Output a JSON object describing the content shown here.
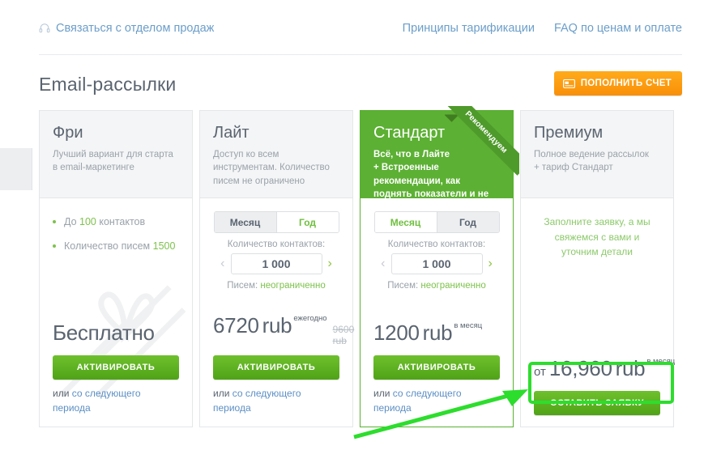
{
  "topbar": {
    "sales_link": "Связаться с отделом продаж",
    "sales_icon": "headset-icon",
    "links": [
      {
        "label": "Принципы тарификации"
      },
      {
        "label": "FAQ по ценам и оплате"
      }
    ]
  },
  "header": {
    "title": "Email-рассылки",
    "topup_button": "ПОПОЛНИТЬ СЧЕТ",
    "topup_icon": "credit-card-icon"
  },
  "colors": {
    "brand_green": "#5cb033",
    "cta_green": "#5faf1e",
    "accent_orange": "#f99a0d",
    "link_blue": "#6b9ec9",
    "text_gray": "#5a6470",
    "muted_gray": "#9aa2aa",
    "annotation_green": "#2ddd2d"
  },
  "plans": [
    {
      "id": "free",
      "name": "Фри",
      "description": "Лучший вариант для старта в email-маркетинге",
      "featured": false,
      "features": [
        {
          "prefix": "До ",
          "value": "100",
          "suffix": " контактов"
        },
        {
          "prefix": "Количество писем ",
          "value": "1500",
          "suffix": ""
        }
      ],
      "price": {
        "prefix": "",
        "amount": "Бесплатно",
        "currency": "",
        "period": "",
        "old": ""
      },
      "cta": "АКТИВИРОВАТЬ",
      "or_prefix": "или ",
      "or_link": "со следующего периода"
    },
    {
      "id": "light",
      "name": "Лайт",
      "description": "Доступ ко всем инструментам. Количество писем не ограничено",
      "featured": false,
      "toggle": {
        "options": [
          "Месяц",
          "Год"
        ],
        "selected": "Год"
      },
      "contacts_label": "Количество контактов:",
      "contacts_value": "1 000",
      "limit_prefix": "Писем: ",
      "limit_value": "неограниченно",
      "price": {
        "prefix": "",
        "amount": "6720",
        "currency": "rub",
        "period": "ежегодно",
        "old": "9600 rub"
      },
      "cta": "АКТИВИРОВАТЬ",
      "or_prefix": "или ",
      "or_link": "со следующего периода"
    },
    {
      "id": "standard",
      "name": "Стандарт",
      "description": "Всё, что в Лайте\n+ Встроенные рекомендации, как поднять показатели и не попасть в спам",
      "featured": true,
      "ribbon": "Рекомендуем",
      "toggle": {
        "options": [
          "Месяц",
          "Год"
        ],
        "selected": "Месяц"
      },
      "contacts_label": "Количество контактов:",
      "contacts_value": "1 000",
      "limit_prefix": "Писем: ",
      "limit_value": "неограниченно",
      "price": {
        "prefix": "",
        "amount": "1200",
        "currency": "rub",
        "period": "в месяц",
        "old": ""
      },
      "cta": "АКТИВИРОВАТЬ",
      "or_prefix": "или ",
      "or_link": "со следующего периода"
    },
    {
      "id": "premium",
      "name": "Премиум",
      "description": "Полное ведение рассылок\n+ тариф Стандарт",
      "featured": false,
      "note": "Заполните заявку, а мы свяжемся с вами и уточним детали",
      "price": {
        "prefix": "от ",
        "amount": "16,960",
        "currency": "rub",
        "period": "в месяц",
        "old": ""
      },
      "cta": "ОСТАВИТЬ ЗАЯВКУ",
      "or_prefix": "",
      "or_link": ""
    }
  ],
  "annotation": {
    "highlight_target": "premium-cta-button",
    "arrow": "green-arrow-pointing-to-premium-cta"
  }
}
